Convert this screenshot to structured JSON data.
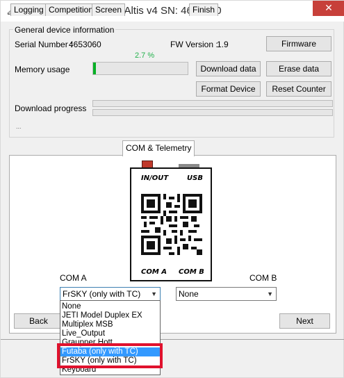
{
  "window": {
    "title": "Altis v4  SN: 4653060",
    "close_glyph": "✕"
  },
  "general": {
    "group_title": "General device information",
    "serial_label": "Serial Number :",
    "serial_value": "4653060",
    "fw_label": "FW Version :",
    "fw_value": "1.9",
    "memory_label": "Memory usage",
    "memory_percent_text": "2.7 %",
    "memory_percent": 2.7,
    "download_progress_label": "Download progress",
    "download_progress_percent": 0,
    "status_text": "...",
    "buttons": {
      "firmware": "Firmware",
      "download_data": "Download data",
      "erase_data": "Erase data",
      "format_device": "Format Device",
      "reset_counter": "Reset Counter"
    }
  },
  "tabs": [
    "Logging",
    "Competition",
    "Screen",
    "COM & Telemetry",
    "Finish"
  ],
  "active_tab": "COM & Telemetry",
  "device_diagram": {
    "in_out": "IN/OUT",
    "usb": "USB",
    "com_a": "COM A",
    "com_b": "COM B"
  },
  "com_a": {
    "label": "COM A",
    "selected": "FrSKY (only with TC)",
    "options": [
      "None",
      "JETI Model Duplex EX",
      "Multiplex MSB",
      "Live_Output",
      "Graupner Hott",
      "Futaba (only with TC)",
      "FrSKY (only with TC)",
      "Keyboard"
    ],
    "highlighted_option": "Futaba (only with TC)"
  },
  "com_b": {
    "label": "COM B",
    "selected": "None"
  },
  "nav": {
    "back": "Back",
    "next": "Next"
  },
  "colors": {
    "close_button": "#c7403a",
    "progress_fill": "#06b025",
    "percent_text": "#22b14c",
    "selection": "#3399ff",
    "annotation_box": "#e0112d"
  },
  "icons": {
    "app": "pencil-app-icon",
    "close": "close-icon",
    "dropdown": "chevron-down-icon",
    "qr": "qr-code-icon"
  }
}
